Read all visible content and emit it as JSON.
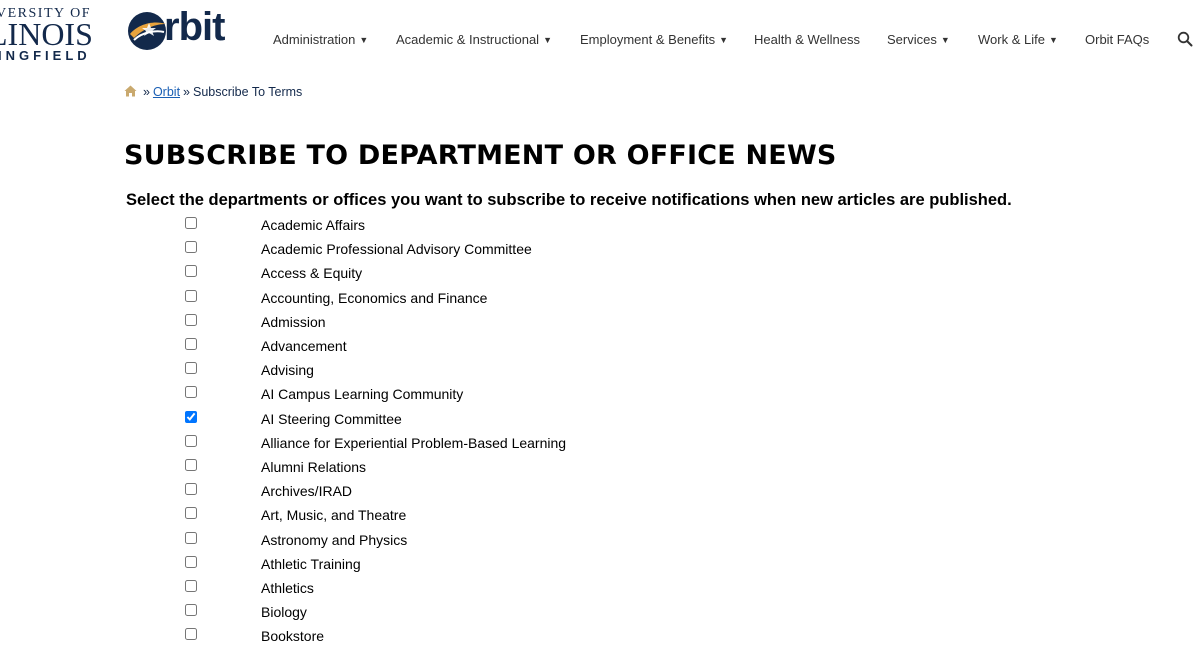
{
  "logo": {
    "uis_line1": "VERSITY OF",
    "uis_line2": "LINOIS",
    "uis_line3": "INGFIELD",
    "orbit_text": "rbit"
  },
  "nav": {
    "items": [
      {
        "label": "Administration",
        "dropdown": true
      },
      {
        "label": "Academic & Instructional",
        "dropdown": true
      },
      {
        "label": "Employment & Benefits",
        "dropdown": true
      },
      {
        "label": "Health & Wellness",
        "dropdown": false
      },
      {
        "label": "Services",
        "dropdown": true
      },
      {
        "label": "Work & Life",
        "dropdown": true
      },
      {
        "label": "Orbit FAQs",
        "dropdown": false
      }
    ],
    "search_icon": "search-icon"
  },
  "breadcrumb": {
    "home_icon": "home-icon",
    "sep": "»",
    "link": "Orbit",
    "current": "Subscribe To Terms"
  },
  "page": {
    "title": "SUBSCRIBE TO DEPARTMENT OR OFFICE NEWS",
    "instructions": "Select the departments or offices you want to subscribe to receive notifications when new articles are published."
  },
  "departments": [
    {
      "label": "Academic Affairs",
      "checked": false
    },
    {
      "label": "Academic Professional Advisory Committee",
      "checked": false
    },
    {
      "label": "Access & Equity",
      "checked": false
    },
    {
      "label": "Accounting, Economics and Finance",
      "checked": false
    },
    {
      "label": "Admission",
      "checked": false
    },
    {
      "label": "Advancement",
      "checked": false
    },
    {
      "label": "Advising",
      "checked": false
    },
    {
      "label": "AI Campus Learning Community",
      "checked": false
    },
    {
      "label": "AI Steering Committee",
      "checked": true
    },
    {
      "label": "Alliance for Experiential Problem-Based Learning",
      "checked": false
    },
    {
      "label": "Alumni Relations",
      "checked": false
    },
    {
      "label": "Archives/IRAD",
      "checked": false
    },
    {
      "label": "Art, Music, and Theatre",
      "checked": false
    },
    {
      "label": "Astronomy and Physics",
      "checked": false
    },
    {
      "label": "Athletic Training",
      "checked": false
    },
    {
      "label": "Athletics",
      "checked": false
    },
    {
      "label": "Biology",
      "checked": false
    },
    {
      "label": "Bookstore",
      "checked": false
    }
  ],
  "colors": {
    "brand_navy": "#13294b",
    "brand_gold": "#e8a33d",
    "link_blue": "#1a5fb4",
    "nav_text": "#333333"
  }
}
